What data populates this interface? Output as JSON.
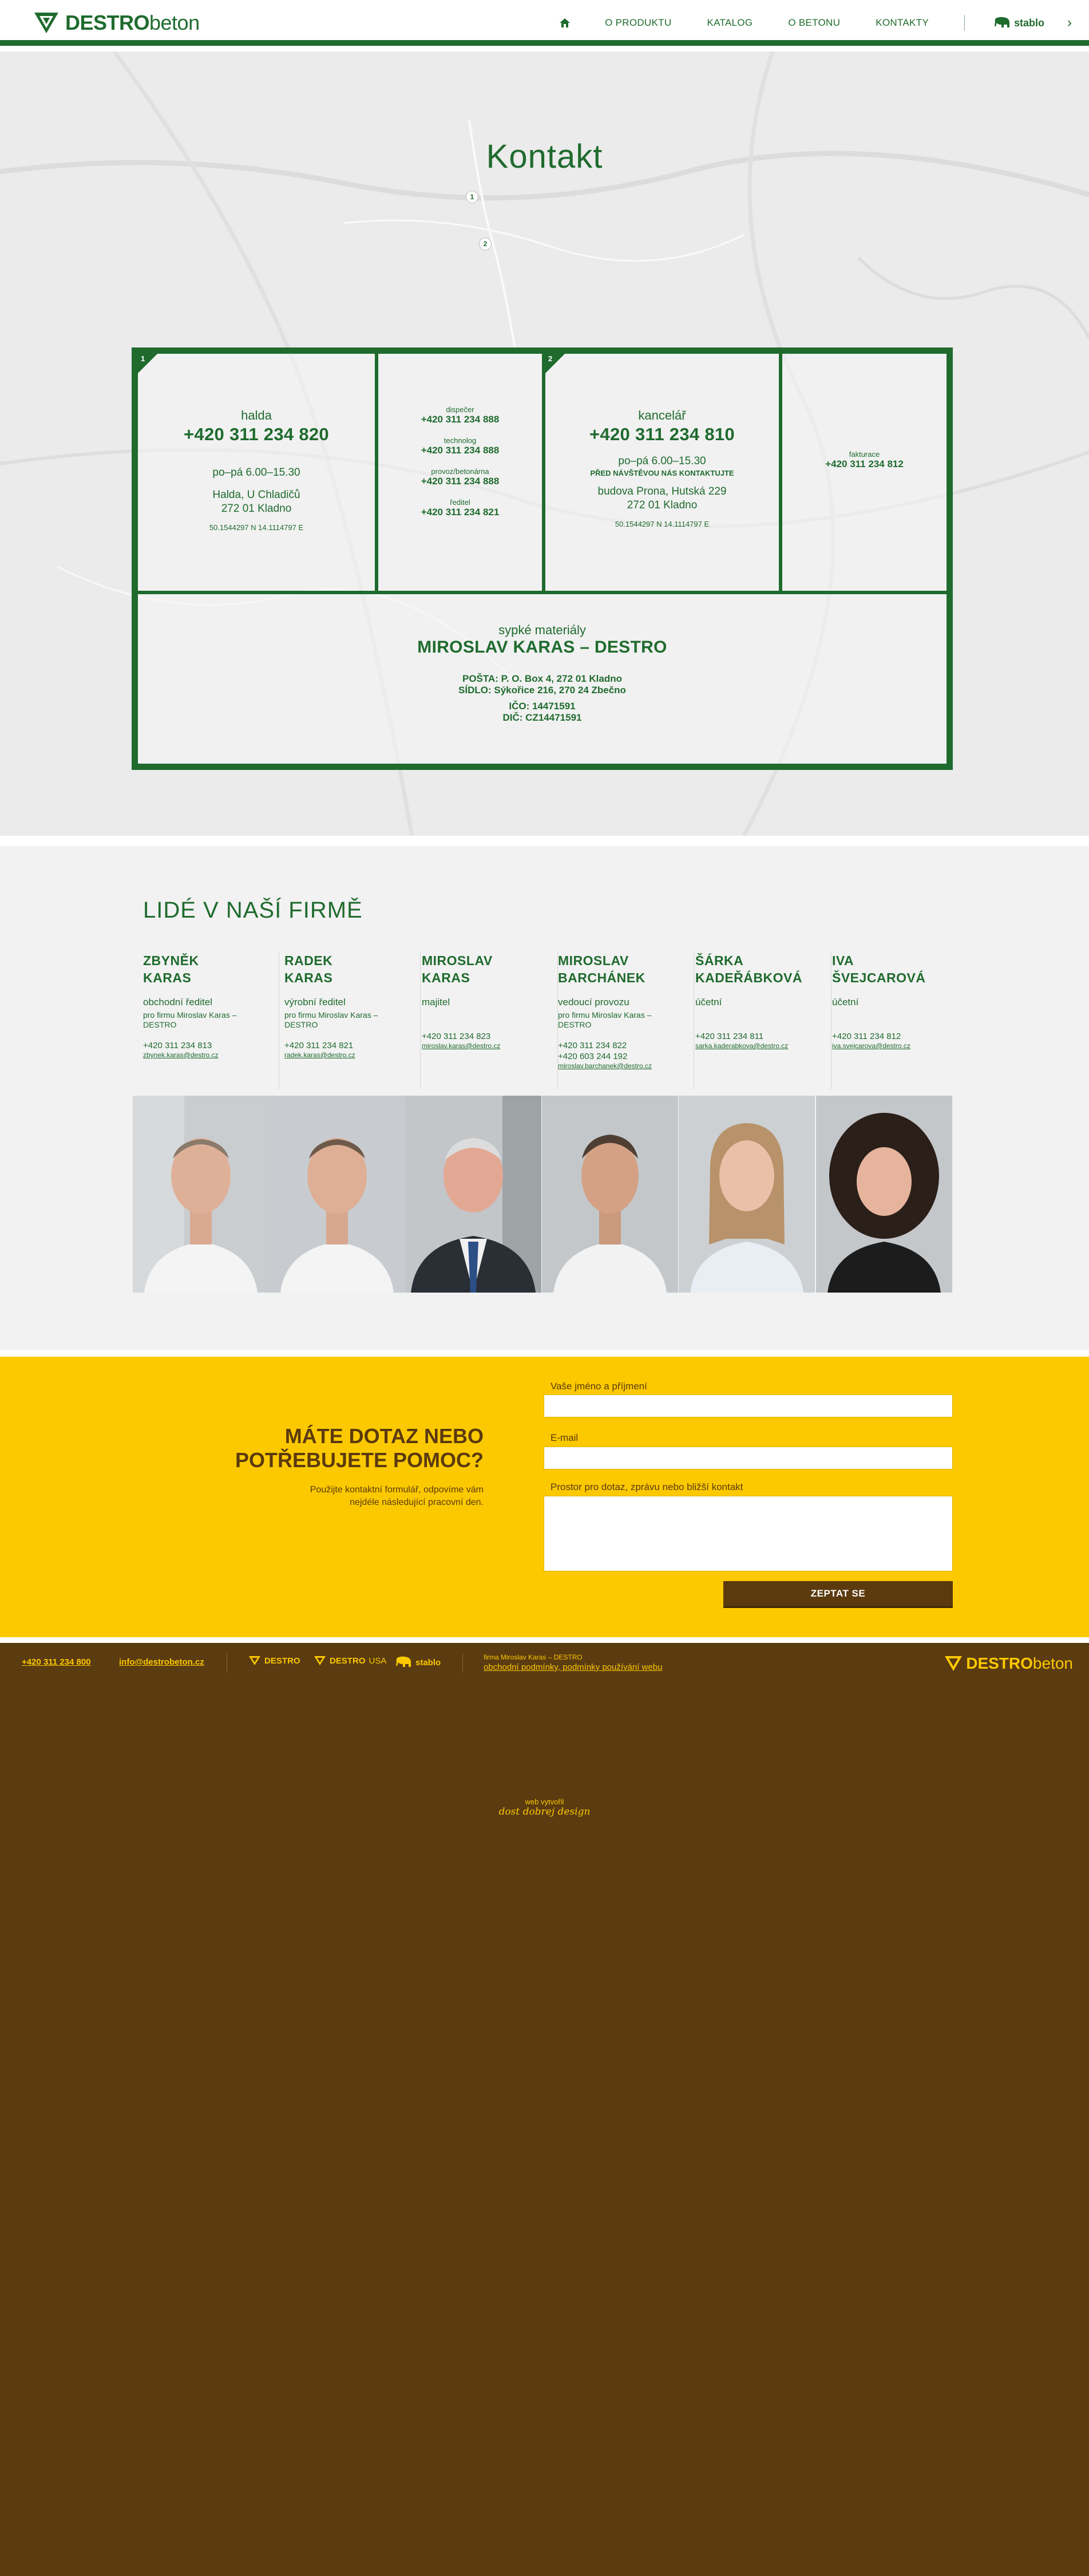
{
  "header": {
    "brand_bold": "DESTRO",
    "brand_light": "beton",
    "nav": [
      "O PRODUKTU",
      "KATALOG",
      "O BETONU",
      "KONTAKTY"
    ],
    "stablo": "stablo"
  },
  "contact": {
    "title": "Kontakt",
    "pins": [
      "1",
      "2"
    ],
    "halda": {
      "num": "1",
      "label": "halda",
      "phone": "+420 311 234 820",
      "hours": "po–pá 6.00–15.30",
      "addr1": "Halda, U Chladičů",
      "addr2": "272 01  Kladno",
      "gps": "50.1544297 N    14.1114797 E",
      "dispecer_lbl": "dispečer",
      "dispecer": "+420 311 234 888",
      "technolog_lbl": "technolog",
      "technolog": "+420 311 234 888",
      "provoz_lbl": "provoz/betonárna",
      "provoz": "+420 311 234 888",
      "reditel_lbl": "ředitel",
      "reditel": "+420 311 234 821"
    },
    "kancelar": {
      "num": "2",
      "label": "kancelář",
      "phone": "+420 311 234 810",
      "hours": "po–pá 6.00–15.30",
      "note": "PŘED NÁVŠTĚVOU NÁS KONTAKTUJTE",
      "addr1": "budova Prona, Hutská 229",
      "addr2": "272 01  Kladno",
      "gps": "50.1544297 N    14.1114797 E",
      "fakturace_lbl": "fakturace",
      "fakturace": "+420 311 234 812"
    },
    "company": {
      "label": "sypké materiály",
      "name": "MIROSLAV KARAS – DESTRO",
      "posta": "POŠTA: P. O. Box 4, 272 01  Kladno",
      "sidlo": "SÍDLO: Sýkořice 216, 270 24  Zbečno",
      "ico": "IČO: 14471591",
      "dic": "DIČ: CZ14471591"
    }
  },
  "people": {
    "title": "LIDÉ V NAŠÍ FIRMĚ",
    "list": [
      {
        "first": "ZBYNĚK",
        "last": "KARAS",
        "role": "obchodní ředitel",
        "sub": "pro firmu Miroslav Karas – DESTRO",
        "phone": "+420 311 234 813",
        "phone2": "",
        "email": "zbynek.karas@destro.cz"
      },
      {
        "first": "RADEK",
        "last": "KARAS",
        "role": "výrobní ředitel",
        "sub": "pro firmu Miroslav Karas – DESTRO",
        "phone": "+420 311 234 821",
        "phone2": "",
        "email": "radek.karas@destro.cz"
      },
      {
        "first": "MIROSLAV",
        "last": "KARAS",
        "role": "majitel",
        "sub": "",
        "phone": "+420 311 234 823",
        "phone2": "",
        "email": "miroslav.karas@destro.cz"
      },
      {
        "first": "MIROSLAV",
        "last": "BARCHÁNEK",
        "role": "vedoucí provozu",
        "sub": "pro firmu Miroslav Karas – DESTRO",
        "phone": "+420 311 234 822",
        "phone2": "+420 603 244 192",
        "email": "miroslav.barchanek@destro.cz"
      },
      {
        "first": "ŠÁRKA",
        "last": "KADEŘÁBKOVÁ",
        "role": "účetní",
        "sub": "",
        "phone": "+420 311 234 811",
        "phone2": "",
        "email": "sarka.kaderabkova@destro.cz"
      },
      {
        "first": "IVA",
        "last": "ŠVEJCAROVÁ",
        "role": "účetní",
        "sub": "",
        "phone": "+420 311 234 812",
        "phone2": "",
        "email": "iva.svejcarova@destro.cz"
      }
    ]
  },
  "form": {
    "headline1": "MÁTE DOTAZ NEBO",
    "headline2": "POTŘEBUJETE POMOC?",
    "desc": "Použijte kontaktní formulář, odpovíme vám nejdéle následující pracovní den.",
    "name_label": "Vaše jméno a příjmení",
    "email_label": "E-mail",
    "msg_label": "Prostor pro dotaz, zprávu nebo bližší kontakt",
    "submit": "ZEPTAT SE"
  },
  "footer": {
    "phone": "+420 311 234 800",
    "email": "info@destrobeton.cz",
    "brand1": "DESTRO",
    "brand2a": "DESTRO",
    "brand2b": "USA",
    "brand3": "stablo",
    "firm": "firma Miroslav Karas – DESTRO",
    "terms": "obchodní podmínky, podmínky používání webu",
    "logo_bold": "DESTRO",
    "logo_light": "beton",
    "credit1": "web vytvořil",
    "credit2": "dost dobrej design"
  },
  "colors": {
    "green": "#1f6b2e",
    "yellow": "#fcc900",
    "brown": "#5b3b10"
  }
}
